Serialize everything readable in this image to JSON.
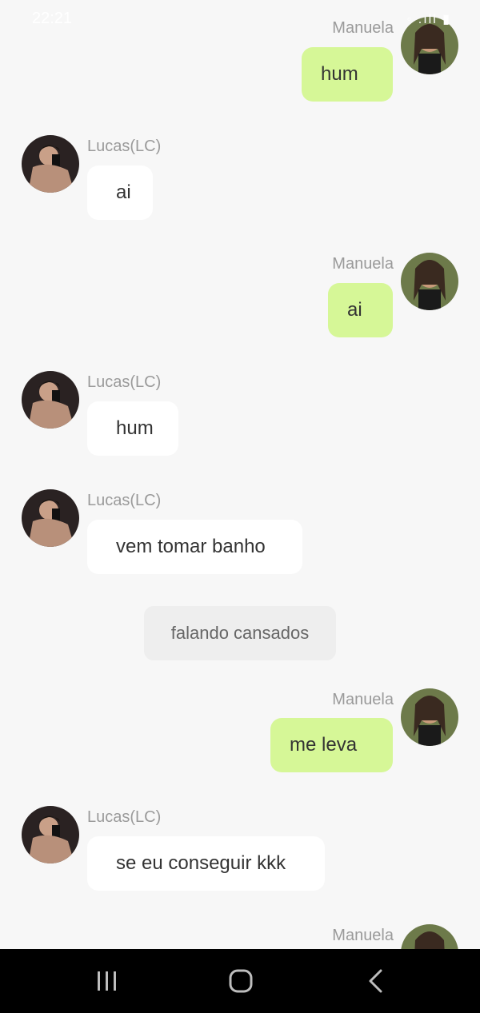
{
  "status_bar": {
    "time": "22:21",
    "indicators": "◦ .ıll ▮"
  },
  "chat": {
    "messages": [
      {
        "sender": "Manuela",
        "text": "hum",
        "direction": "out"
      },
      {
        "sender": "Lucas(LC)",
        "text": "ai",
        "direction": "in"
      },
      {
        "sender": "Manuela",
        "text": "ai",
        "direction": "out"
      },
      {
        "sender": "Lucas(LC)",
        "text": "hum",
        "direction": "in"
      },
      {
        "sender": "Lucas(LC)",
        "text": "vem tomar banho",
        "direction": "in"
      },
      {
        "system_note": "falando cansados"
      },
      {
        "sender": "Manuela",
        "text": "me leva",
        "direction": "out"
      },
      {
        "sender": "Lucas(LC)",
        "text": "se eu conseguir kkk",
        "direction": "in"
      },
      {
        "sender": "Manuela",
        "text": "",
        "direction": "out"
      }
    ]
  },
  "navbar": {
    "buttons": [
      "recent-apps-icon",
      "home-icon",
      "back-icon"
    ]
  },
  "colors": {
    "outgoing_bubble": "#d6f797",
    "incoming_bubble": "#ffffff",
    "system_bubble": "#eeeeee",
    "background": "#f7f7f7"
  }
}
